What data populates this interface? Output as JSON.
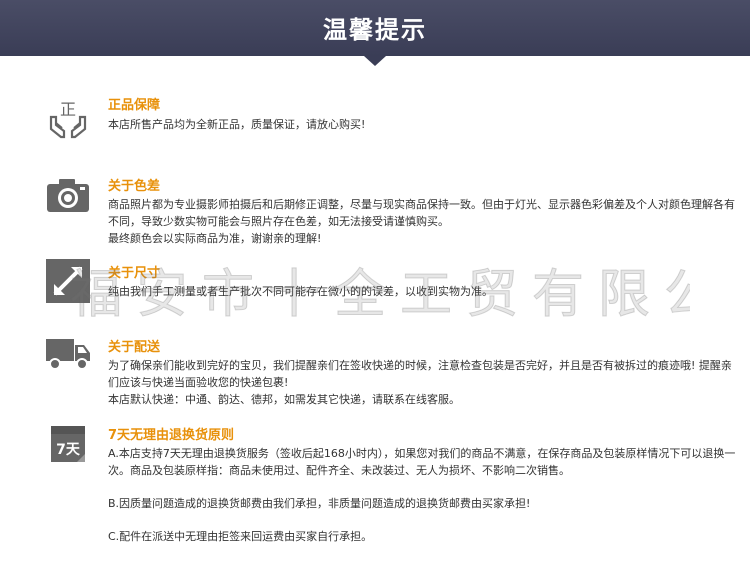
{
  "header": {
    "title": "温馨提示"
  },
  "watermark": "福安市十全工贸有限公司",
  "sections": [
    {
      "icon": "hands-authentic-icon",
      "title": "正品保障",
      "lines": [
        "本店所售产品均为全新正品，质量保证，请放心购买!"
      ]
    },
    {
      "icon": "camera-icon",
      "title": "关于色差",
      "lines": [
        "商品照片都为专业摄影师拍摄后和后期修正调整，尽量与现实商品保持一致。但由于灯光、显示器色彩偏差及个人对颜色理解各有不同，导致少数实物可能会与照片存在色差，如无法接受请谨慎购买。",
        "最终颜色会以实际商品为准，谢谢亲的理解!"
      ]
    },
    {
      "icon": "resize-arrow-icon",
      "title": "关于尺寸",
      "lines": [
        "纯由我们手工测量或者生产批次不同可能存在微小的的误差，以收到实物为准。"
      ]
    },
    {
      "icon": "truck-icon",
      "title": "关于配送",
      "lines": [
        "为了确保亲们能收到完好的宝贝，我们提醒亲们在签收快递的时候，注意检查包装是否完好，并且是否有被拆过的痕迹哦! 提醒亲们应该与快递当面验收您的快递包裹!",
        "本店默认快递：中通、韵达、德邦，如需发其它快递，请联系在线客服。"
      ]
    },
    {
      "icon": "seven-day-calendar-icon",
      "icon_text": "7天",
      "title": "7天无理由退换货原则",
      "lines": [
        "A.本店支持7天无理由退换货服务（签收后起168小时内），如果您对我们的商品不满意，在保存商品及包装原样情况下可以退换一次。商品及包装原样指：商品未使用过、配件齐全、未改装过、无人为损坏、不影响二次销售。",
        "B.因质量问题造成的退换货邮费由我们承担，非质量问题造成的退换货邮费由买家承担!",
        "C.配件在派送中无理由拒签来回运费由买家自行承担。"
      ]
    }
  ]
}
